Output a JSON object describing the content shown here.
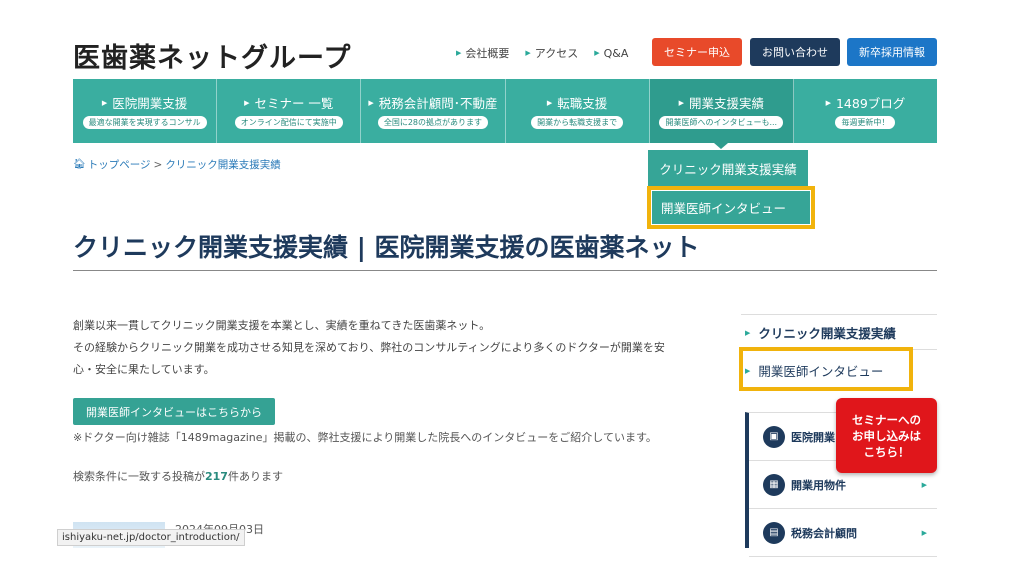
{
  "header": {
    "logo": "医歯薬ネットグループ",
    "links": [
      "会社概要",
      "アクセス",
      "Q&A"
    ],
    "buttons": [
      {
        "label": "セミナー申込",
        "color": "#e84a2a"
      },
      {
        "label": "お問い合わせ",
        "color": "#1e3a5c"
      },
      {
        "label": "新卒採用情報",
        "color": "#1c76c7"
      }
    ]
  },
  "nav": [
    {
      "title": "医院開業支援",
      "sub": "最適な開業を実現するコンサル"
    },
    {
      "title": "セミナー 一覧",
      "sub": "オンライン配信にて実施中"
    },
    {
      "title": "税務会計顧問･不動産",
      "sub": "全国に28の拠点があります"
    },
    {
      "title": "転職支援",
      "sub": "開業から転職支援まで"
    },
    {
      "title": "開業支援実績",
      "sub": "開業医師へのインタビューも..."
    },
    {
      "title": "1489ブログ",
      "sub": "毎週更新中！"
    }
  ],
  "dropdown": {
    "item1": "クリニック開業支援実績",
    "item2": "開業医師インタビュー"
  },
  "breadcrumb": {
    "home": "トップページ",
    "separator": ">",
    "current": "クリニック開業支援実績"
  },
  "page": {
    "title": "クリニック開業支援実績 | 医院開業支援の医歯薬ネット",
    "paragraph_line1": "創業以来一貫してクリニック開業支援を本業とし、実績を重ねてきた医歯薬ネット。",
    "paragraph_line2": "その経験からクリニック開業を成功させる知見を深めており、弊社のコンサルティングにより多くのドクターが開業を安",
    "paragraph_line3": "心・安全に果たしています。",
    "cta": "開業医師インタビューはこちらから",
    "note": "※ドクター向け雑誌「1489magazine」掲載の、弊社支援により開業した院長へのインタビューをご紹介しています。",
    "count_prefix": "検索条件に一致する投稿が",
    "count_value": "217",
    "count_suffix": "件あります",
    "post_date": "2024年09月03日",
    "status_url": "ishiyaku-net.jp/doctor_introduction/"
  },
  "sidebar": {
    "link1": "クリニック開業支援実績",
    "link2": "開業医師インタビュー",
    "rows": [
      {
        "label": "医院開業",
        "icon": "briefcase-icon"
      },
      {
        "label": "開業用物件",
        "icon": "building-icon"
      },
      {
        "label": "税務会計顧問",
        "icon": "calculator-icon"
      }
    ],
    "seminar_line1": "セミナーへの",
    "seminar_line2": "お申し込みは",
    "seminar_line3": "こちら！"
  },
  "colors": {
    "teal": "#3aaea0",
    "navy": "#1e3a5c",
    "highlight": "#f1b30c",
    "red": "#e0161b"
  }
}
